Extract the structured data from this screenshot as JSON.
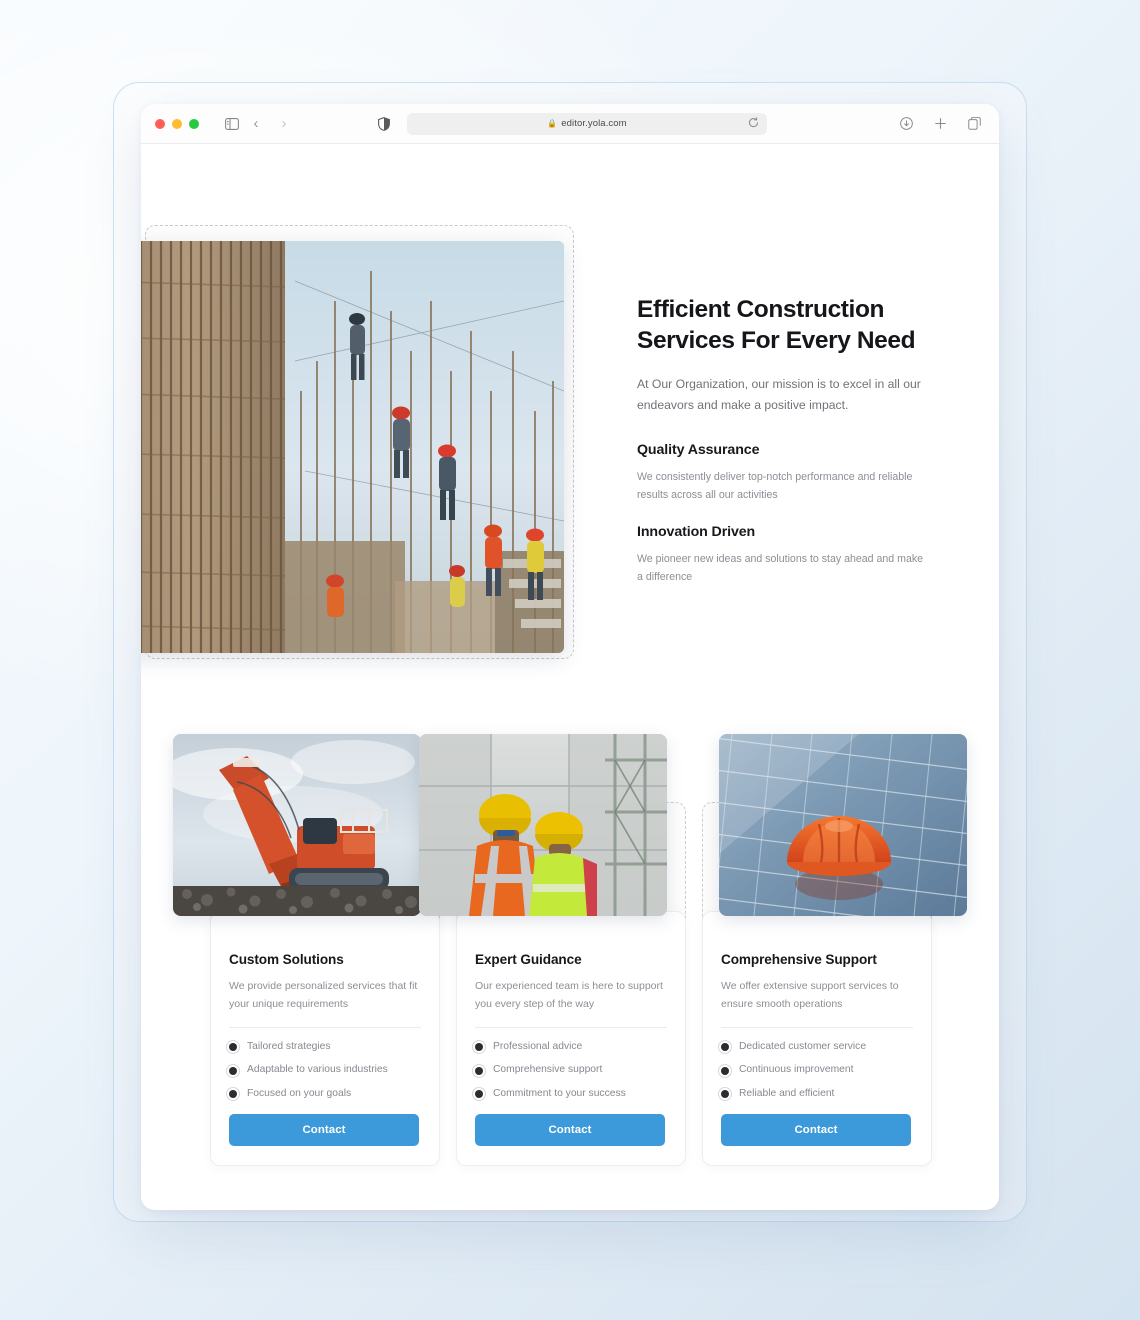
{
  "browser": {
    "traffic_lights": [
      "close",
      "minimize",
      "maximize"
    ],
    "sidebar_icon": "sidebar-icon",
    "back_label": "‹",
    "forward_label": "›",
    "shield_icon": "shield-icon",
    "lock_icon": "🔒",
    "url": "editor.yola.com",
    "reload_icon": "reload-icon",
    "download_icon": "download-icon",
    "new_tab_icon": "plus-icon",
    "tabs_icon": "copy-tabs-icon"
  },
  "hero": {
    "title": "Efficient Construction Services For Every Need",
    "subtitle": "At Our Organization, our mission is to excel in all our endeavors and make a positive impact.",
    "image_alt": "construction-workers-rebar-site",
    "features": [
      {
        "title": "Quality Assurance",
        "body": "We consistently deliver top-notch performance and reliable results across all our activities"
      },
      {
        "title": "Innovation Driven",
        "body": "We pioneer new ideas and solutions to stay ahead and make a difference"
      }
    ]
  },
  "cards": [
    {
      "image_alt": "orange-excavator",
      "title": "Custom Solutions",
      "description": "We provide personalized services that fit your unique requirements",
      "bullets": [
        "Tailored strategies",
        "Adaptable to various industries",
        "Focused on your goals"
      ],
      "button_label": "Contact"
    },
    {
      "image_alt": "two-workers-hardhats-site",
      "title": "Expert Guidance",
      "description": "Our experienced team is here to support you every step of the way",
      "bullets": [
        "Professional advice",
        "Comprehensive support",
        "Commitment to your success"
      ],
      "button_label": "Contact"
    },
    {
      "image_alt": "orange-hardhat-on-solar-panel",
      "title": "Comprehensive Support",
      "description": "We offer extensive support services to ensure smooth operations",
      "bullets": [
        "Dedicated customer service",
        "Continuous improvement",
        "Reliable and efficient"
      ],
      "button_label": "Contact"
    }
  ],
  "colors": {
    "accent": "#3c9ada",
    "heading": "#16181c",
    "body_text": "#8b8f95",
    "dashed_outline": "#cdcdcd",
    "page_bg_start": "#f7fbfd",
    "page_bg_end": "#d4e3f0"
  }
}
